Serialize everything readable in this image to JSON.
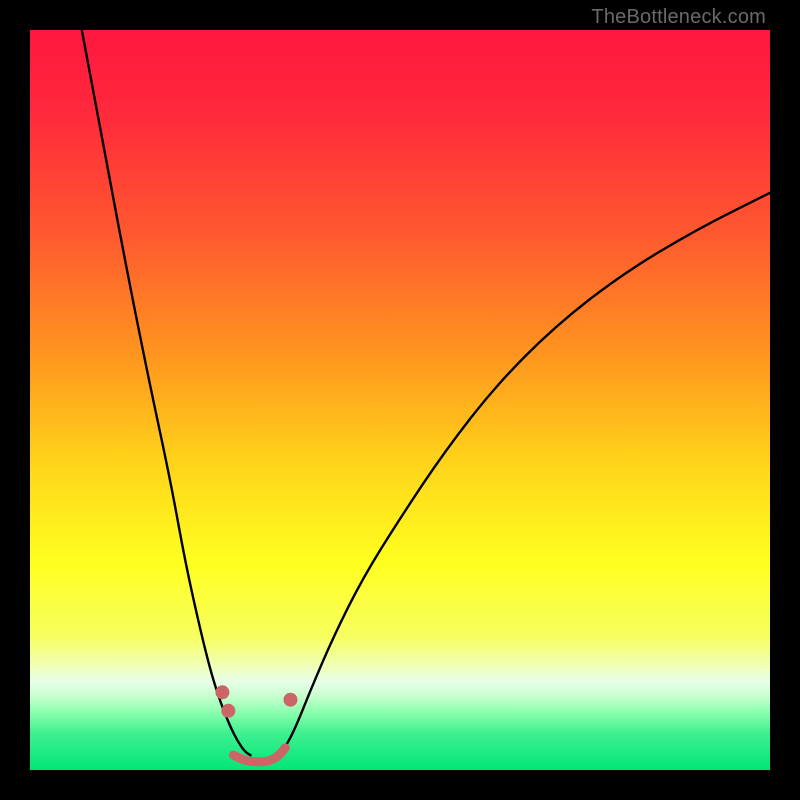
{
  "watermark": "TheBottleneck.com",
  "gradient_stops": [
    {
      "offset": "0%",
      "color": "#ff173f"
    },
    {
      "offset": "12%",
      "color": "#ff2b3b"
    },
    {
      "offset": "28%",
      "color": "#ff5a2f"
    },
    {
      "offset": "45%",
      "color": "#ff9a1e"
    },
    {
      "offset": "58%",
      "color": "#ffd21a"
    },
    {
      "offset": "72%",
      "color": "#ffff20"
    },
    {
      "offset": "82%",
      "color": "#f7ff60"
    },
    {
      "offset": "86%",
      "color": "#f0ffb8"
    },
    {
      "offset": "88%",
      "color": "#e8ffe8"
    },
    {
      "offset": "90%",
      "color": "#c8ffd0"
    },
    {
      "offset": "92%",
      "color": "#90ffb0"
    },
    {
      "offset": "95%",
      "color": "#40f090"
    },
    {
      "offset": "100%",
      "color": "#00e676"
    }
  ],
  "chart_data": {
    "type": "line",
    "title": "",
    "xlabel": "",
    "ylabel": "",
    "xlim": [
      0,
      100
    ],
    "ylim": [
      0,
      100
    ],
    "series": [
      {
        "name": "left-arm",
        "stroke": "#000000",
        "stroke_width": 2.4,
        "x": [
          7,
          10,
          13,
          16,
          19,
          21,
          23,
          24.5,
          25.8,
          27,
          28,
          29,
          29.8
        ],
        "y": [
          100,
          84,
          68,
          53,
          39,
          28,
          19,
          13,
          9,
          6,
          4,
          2.5,
          2
        ]
      },
      {
        "name": "right-arm",
        "stroke": "#000000",
        "stroke_width": 2.4,
        "x": [
          33.2,
          34.5,
          36,
          38,
          41,
          45,
          50,
          56,
          63,
          71,
          80,
          90,
          100
        ],
        "y": [
          2,
          3,
          6,
          11,
          18,
          26,
          34,
          43,
          52,
          60,
          67,
          73,
          78
        ]
      },
      {
        "name": "valley-floor",
        "stroke": "#cc6666",
        "stroke_width": 9,
        "x": [
          27.5,
          28.5,
          29.5,
          30.5,
          31.5,
          32.5,
          33.5,
          34.5
        ],
        "y": [
          2,
          1.5,
          1.2,
          1.1,
          1.1,
          1.3,
          1.8,
          3
        ]
      }
    ],
    "markers": [
      {
        "name": "left-dot-upper",
        "x": 26.0,
        "y": 10.5,
        "r": 7,
        "fill": "#cc6666"
      },
      {
        "name": "left-dot-lower",
        "x": 26.8,
        "y": 8.0,
        "r": 7,
        "fill": "#cc6666"
      },
      {
        "name": "right-dot",
        "x": 35.2,
        "y": 9.5,
        "r": 7,
        "fill": "#cc6666"
      }
    ]
  }
}
